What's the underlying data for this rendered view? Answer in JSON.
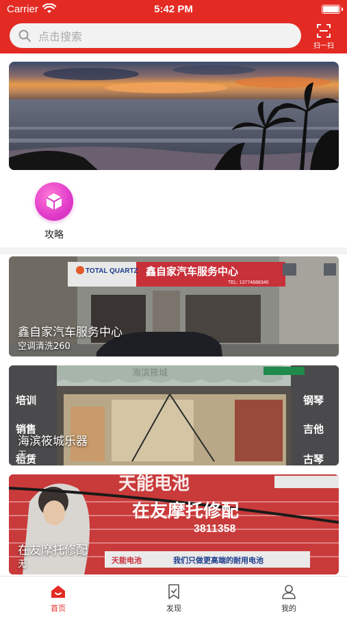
{
  "status_bar": {
    "carrier": "Carrier",
    "time": "5:42 PM"
  },
  "search": {
    "placeholder": "点击搜索"
  },
  "scan": {
    "label": "扫一扫",
    "icon": "scan-icon"
  },
  "banner": {
    "icon": "sunset-beach-banner"
  },
  "categories": [
    {
      "label": "攻略",
      "icon": "cube-icon"
    }
  ],
  "listings": [
    {
      "title": "鑫自家汽车服务中心",
      "subtitle": "空调清洗260",
      "sign_text": "鑫自家汽车服务中心",
      "sign_phone": "TEL: 13774688340",
      "sign_brand": "TOTAL QUARTZ"
    },
    {
      "title": "海滨筱城乐器",
      "subtitle": "无",
      "sign_top": "海滨筱城",
      "left_words": [
        "培训",
        "销售",
        "租赁"
      ],
      "right_words": [
        "钢琴",
        "吉他",
        "古琴"
      ]
    },
    {
      "title": "在友摩托修配",
      "subtitle": "无",
      "sign_big": "在友摩托修配",
      "sign_brand": "天能电池",
      "sign_slogan": "我们只做更高端的耐用电池",
      "sign_number": "3811358",
      "sign_top": "天能电池"
    }
  ],
  "tabbar": [
    {
      "label": "首页",
      "icon": "home-icon",
      "active": true
    },
    {
      "label": "发现",
      "icon": "bookmark-icon",
      "active": false
    },
    {
      "label": "我的",
      "icon": "profile-icon",
      "active": false
    }
  ],
  "colors": {
    "brand": "#e32b24",
    "tab_inactive": "#333333",
    "category_icon": "#e03ac9"
  }
}
